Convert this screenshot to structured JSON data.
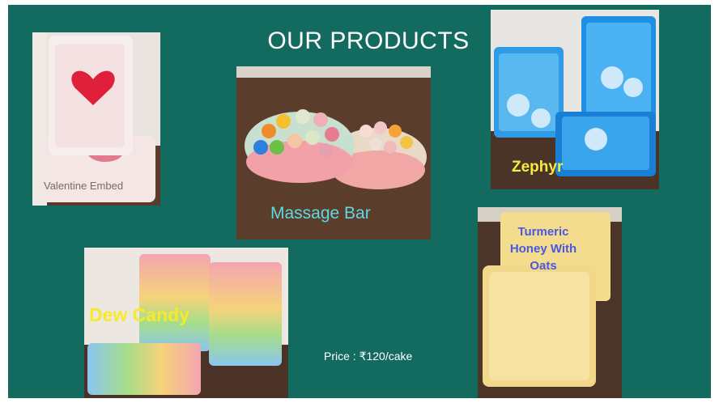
{
  "slide": {
    "title": "OUR PRODUCTS",
    "background_color": "#136b5f",
    "price_text": "Price :  ₹120/cake"
  },
  "products": [
    {
      "id": "valentine",
      "label": "Valentine Embed",
      "label_color": "#7a6b63",
      "image": "soap-photo-red-heart-embed"
    },
    {
      "id": "massage",
      "label": "Massage Bar",
      "label_color": "#5fd8e6",
      "image": "soap-photo-massage-bar-with-beads"
    },
    {
      "id": "zephyr",
      "label": "Zephyr",
      "label_color": "#f4ec3c",
      "image": "soap-photo-blue-bars"
    },
    {
      "id": "dew",
      "label": "Dew Candy",
      "label_color": "#f6ea2a",
      "image": "soap-photo-rainbow-speckled-bars"
    },
    {
      "id": "turmeric",
      "label": "Turmeric Honey With Oats",
      "label_color": "#4a57e3",
      "image": "soap-photo-yellow-oat-bars"
    }
  ]
}
